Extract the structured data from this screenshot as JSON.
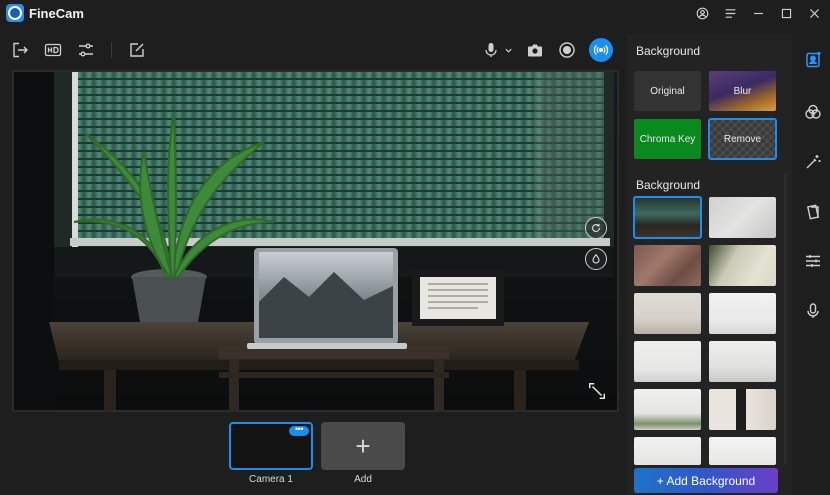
{
  "app": {
    "title": "FineCam"
  },
  "panel": {
    "modes_title": "Background",
    "modes": [
      {
        "label": "Original"
      },
      {
        "label": "Blur"
      },
      {
        "label": "Chroma Key"
      },
      {
        "label": "Remove"
      }
    ],
    "gallery_title": "Background",
    "add_background_label": "+ Add Background"
  },
  "cameras": {
    "items": [
      {
        "label": "Camera 1",
        "more": "•••"
      }
    ],
    "add_label": "Add",
    "add_symbol": "+"
  },
  "colors": {
    "accent": "#1a8ff0",
    "chroma_green": "#0a8a1e",
    "panel": "#232324"
  }
}
